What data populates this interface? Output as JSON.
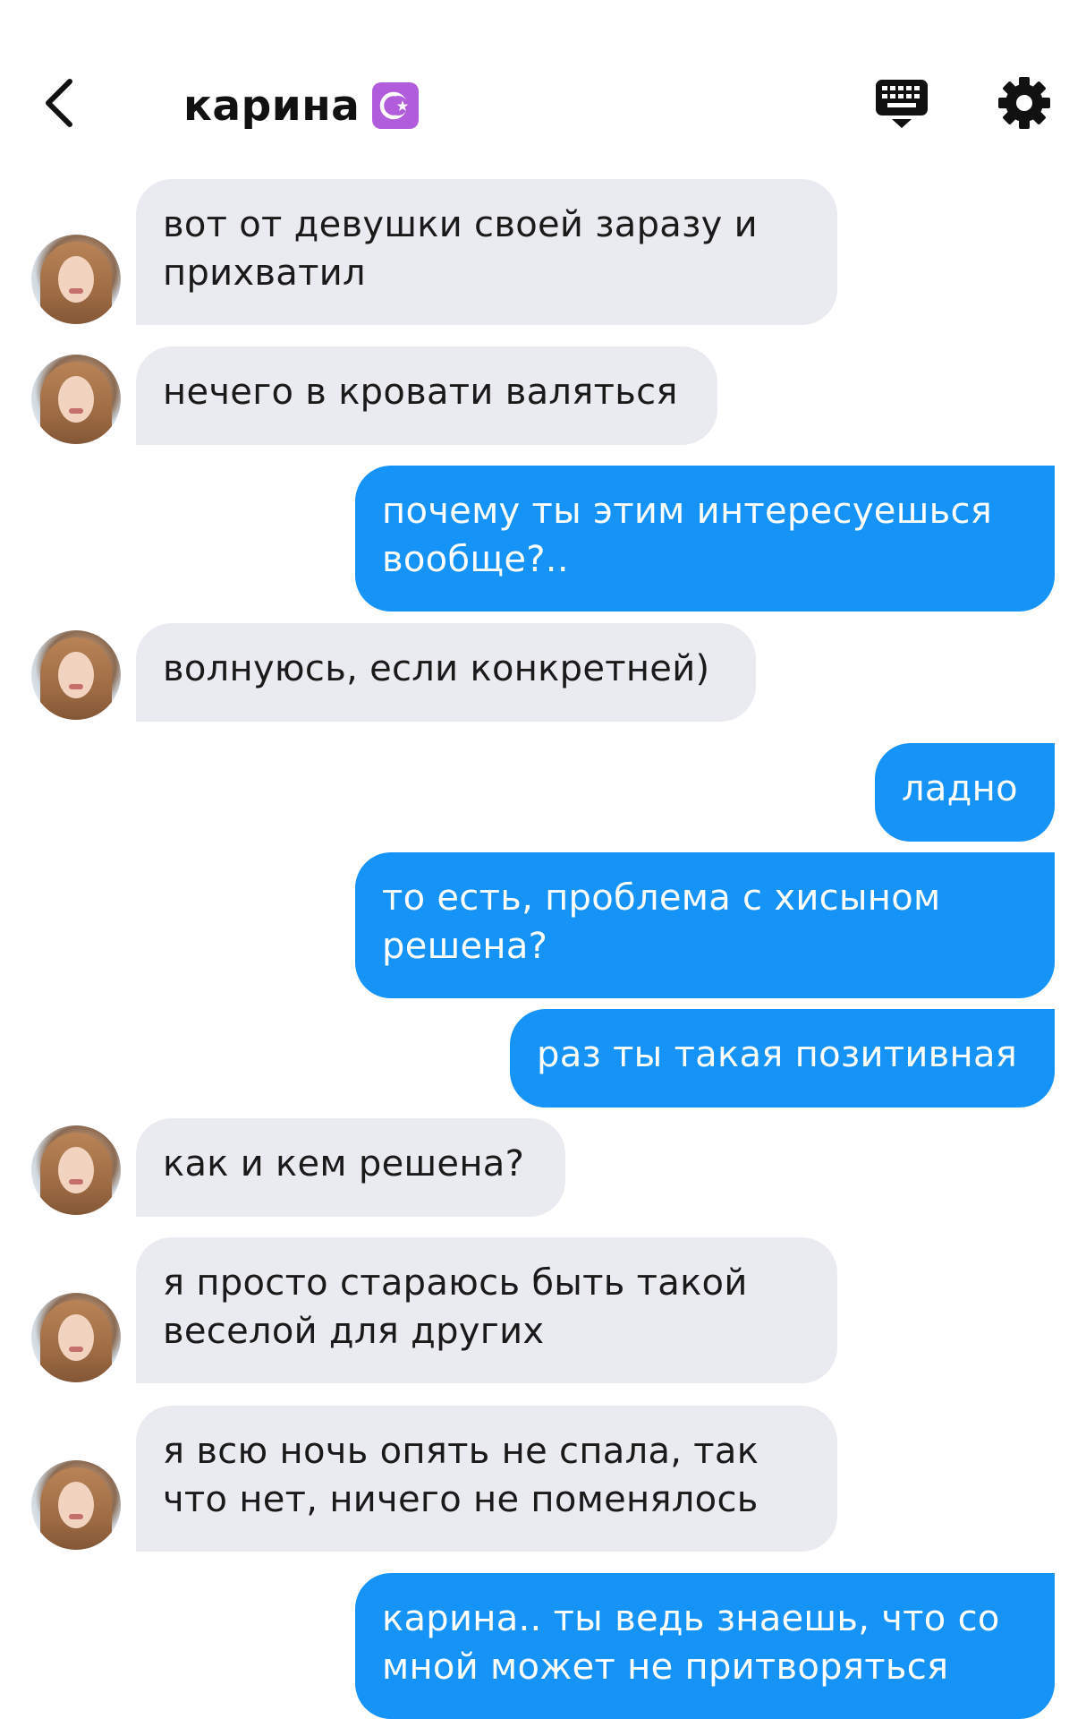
{
  "header": {
    "back_icon": "chevron-left-icon",
    "title": "карина",
    "title_emoji": "☪",
    "keyboard_icon": "keyboard-icon",
    "settings_icon": "gear-icon"
  },
  "colors": {
    "incoming_bubble": "#eaebf1",
    "outgoing_bubble": "#1693f7",
    "emoji_bg": "#b15ddb"
  },
  "messages": [
    {
      "sender": "them",
      "text": "вот от девушки своей заразу и\nприхватил"
    },
    {
      "sender": "them",
      "text": "нечего в кровати валяться"
    },
    {
      "sender": "me",
      "text": "почему ты этим интересуешься\nвообще?.."
    },
    {
      "sender": "them",
      "text": "волнуюсь, если конкретней)"
    },
    {
      "sender": "me",
      "text": "ладно"
    },
    {
      "sender": "me",
      "text": "то есть, проблема с хисыном\nрешена?"
    },
    {
      "sender": "me",
      "text": "раз ты такая позитивная"
    },
    {
      "sender": "them",
      "text": "как и кем решена?"
    },
    {
      "sender": "them",
      "text": "я просто стараюсь быть такой\nвеселой для других"
    },
    {
      "sender": "them",
      "text": "я всю ночь опять не спала, так\nчто нет, ничего не поменялось"
    },
    {
      "sender": "me",
      "text": "карина.. ты ведь знаешь, что со\nмной может не притворяться"
    }
  ]
}
